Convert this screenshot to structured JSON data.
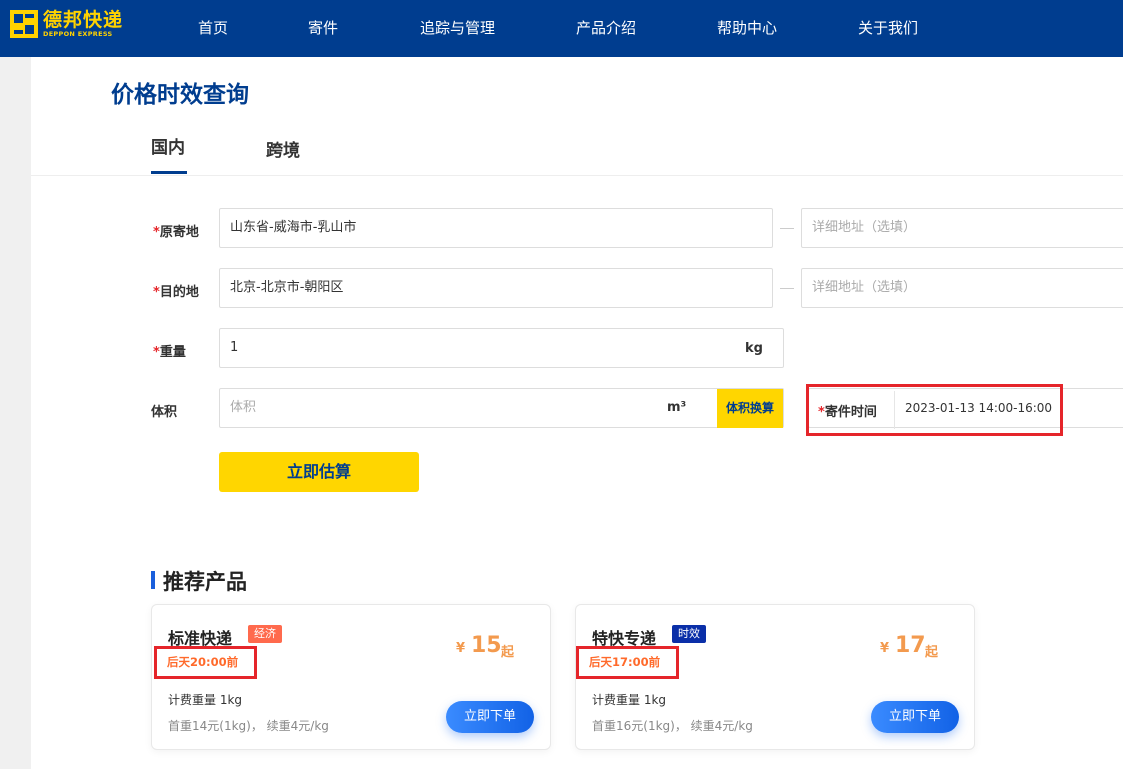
{
  "brand": {
    "name_cn": "德邦快递",
    "name_en": "DEPPON EXPRESS",
    "logo_color": "#ffd200",
    "nav_bg": "#003d8f"
  },
  "nav": {
    "home": "首页",
    "ship": "寄件",
    "track": "追踪与管理",
    "products": "产品介绍",
    "help": "帮助中心",
    "about": "关于我们"
  },
  "page": {
    "title": "价格时效查询"
  },
  "tabs": {
    "domestic": "国内",
    "cross_border": "跨境",
    "active": "国内"
  },
  "form": {
    "origin": {
      "required_mark": "*",
      "label": "原寄地",
      "value": "山东省-威海市-乳山市",
      "detail_placeholder": "详细地址（选填）"
    },
    "destination": {
      "required_mark": "*",
      "label": "目的地",
      "value": "北京-北京市-朝阳区",
      "detail_placeholder": "详细地址（选填）"
    },
    "weight": {
      "required_mark": "*",
      "label": "重量",
      "value": "1",
      "unit": "kg"
    },
    "volume": {
      "label": "体积",
      "placeholder": "体积",
      "unit": "m³",
      "convert_label": "体积换算"
    },
    "ship_time": {
      "required_mark": "*",
      "label": "寄件时间",
      "value": "2023-01-13 14:00-16:00"
    },
    "submit_label": "立即估算"
  },
  "recommend": {
    "title": "推荐产品",
    "products": [
      {
        "name": "标准快递",
        "badge": "经济",
        "badge_color": "#ff6a4d",
        "deadline": "后天20:00前",
        "currency": "¥",
        "price": "15",
        "price_suffix": "起",
        "chargeable_weight": "计费重量 1kg",
        "rates": "首重14元(1kg)， 续重4元/kg",
        "order_label": "立即下单"
      },
      {
        "name": "特快专递",
        "badge": "时效",
        "badge_color": "#0a2fa8",
        "deadline": "后天17:00前",
        "currency": "¥",
        "price": "17",
        "price_suffix": "起",
        "chargeable_weight": "计费重量 1kg",
        "rates": "首重16元(1kg)， 续重4元/kg",
        "order_label": "立即下单"
      }
    ]
  },
  "accent": {
    "highlight_red": "#e5252a",
    "price_orange": "#f39a4e",
    "button_yellow": "#ffd600"
  }
}
